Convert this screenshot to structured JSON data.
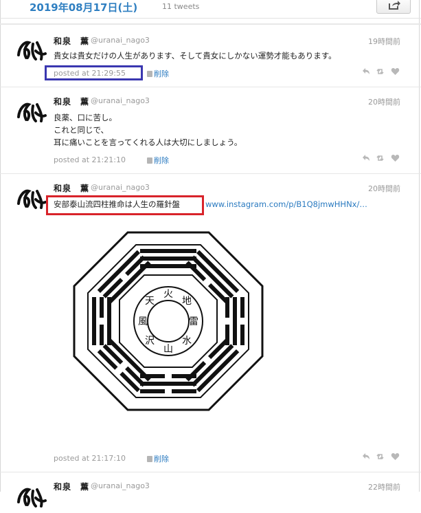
{
  "header": {
    "date": "2019年08月17日(土)",
    "tweet_count": "11 tweets",
    "share_icon": "share-icon"
  },
  "tweets": [
    {
      "name": "和泉　薫",
      "handle": "@uranai_nago3",
      "time": "19時間前",
      "lines": [
        "貴女は貴女だけの人生があります、そして貴女にしかない運勢才能もあります。"
      ],
      "posted": "posted at 21:29:55",
      "delete": "削除"
    },
    {
      "name": "和泉　薫",
      "handle": "@uranai_nago3",
      "time": "20時間前",
      "lines": [
        "良薬、口に苦し。",
        "これと同じで、",
        "耳に痛いことを言ってくれる人は大切にしましょう。"
      ],
      "posted": "posted at 21:21:10",
      "delete": "削除"
    },
    {
      "name": "和泉　薫",
      "handle": "@uranai_nago3",
      "time": "20時間前",
      "text": "安部泰山流四柱推命は人生の羅針盤",
      "link": "www.instagram.com/p/B1Q8jmwHHNx/…",
      "image_chars": [
        "火",
        "地",
        "雷",
        "水",
        "山",
        "沢",
        "風",
        "天"
      ],
      "posted": "posted at 21:17:10",
      "delete": "削除"
    },
    {
      "name": "和泉　薫",
      "handle": "@uranai_nago3",
      "time": "22時間前"
    }
  ],
  "avatar_glyph": "和",
  "annotation_colors": {
    "blue": "#3a37b0",
    "red": "#d8232a"
  }
}
